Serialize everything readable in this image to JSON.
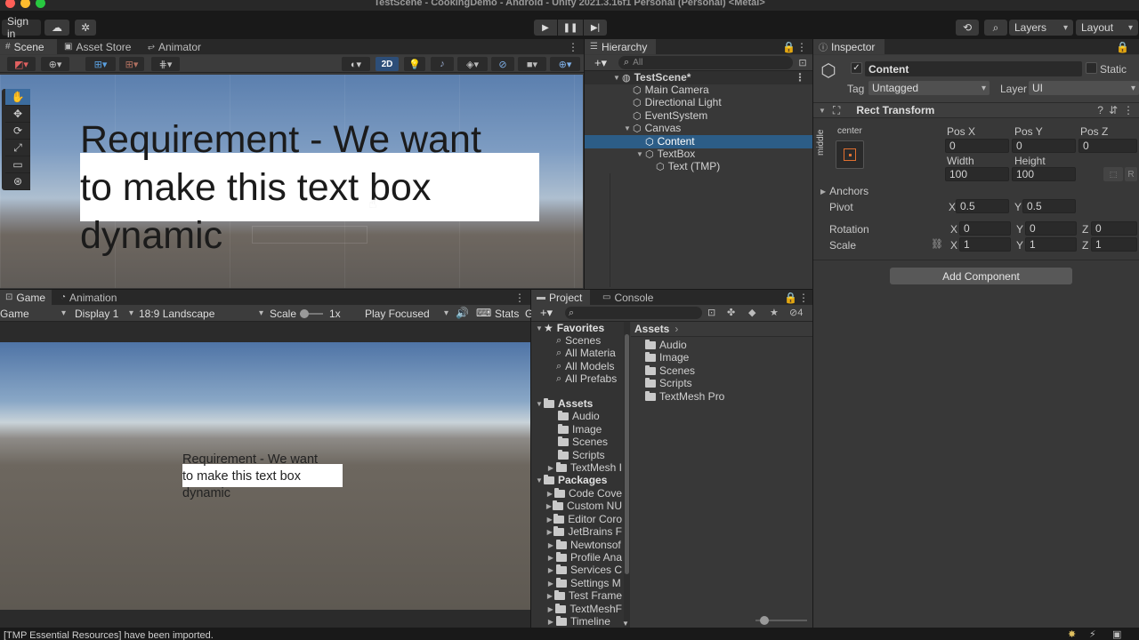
{
  "window": {
    "title": "TestScene - CookingDemo - Android - Unity 2021.3.16f1 Personal (Personal) <Metal>",
    "traffic_colors": [
      "#ff5f57",
      "#febc2e",
      "#28c840"
    ]
  },
  "toolbar": {
    "sign_in": "Sign in",
    "layers": "Layers",
    "layout": "Layout"
  },
  "scene_panel": {
    "tabs": [
      "Scene",
      "Asset Store",
      "Animator"
    ],
    "mode_2d": "2D",
    "text_line1": "Requirement - We want",
    "text_line2": "to make this text box",
    "text_line3": "dynamic"
  },
  "hierarchy": {
    "tab": "Hierarchy",
    "search_placeholder": "All",
    "items": [
      {
        "label": "TestScene*"
      },
      {
        "label": "Main Camera"
      },
      {
        "label": "Directional Light"
      },
      {
        "label": "EventSystem"
      },
      {
        "label": "Canvas"
      },
      {
        "label": "Content"
      },
      {
        "label": "TextBox"
      },
      {
        "label": "Text (TMP)"
      }
    ]
  },
  "inspector": {
    "tab": "Inspector",
    "object_name": "Content",
    "static_label": "Static",
    "tag_label": "Tag",
    "tag_value": "Untagged",
    "layer_label": "Layer",
    "layer_value": "UI",
    "component": "Rect Transform",
    "anchor_preset_h": "center",
    "anchor_preset_v": "middle",
    "pos_x_label": "Pos X",
    "pos_y_label": "Pos Y",
    "pos_z_label": "Pos Z",
    "pos_x": "0",
    "pos_y": "0",
    "pos_z": "0",
    "width_label": "Width",
    "height_label": "Height",
    "width": "100",
    "height": "100",
    "anchors_label": "Anchors",
    "pivot_label": "Pivot",
    "pivot_x": "0.5",
    "pivot_y": "0.5",
    "rotation_label": "Rotation",
    "rot_x": "0",
    "rot_y": "0",
    "rot_z": "0",
    "scale_label": "Scale",
    "scale_x": "1",
    "scale_y": "1",
    "scale_z": "1",
    "x": "X",
    "y": "Y",
    "z": "Z",
    "r": "R",
    "add_component": "Add Component"
  },
  "game_panel": {
    "tabs": [
      "Game",
      "Animation"
    ],
    "mode": "Game",
    "display": "Display 1",
    "aspect": "18:9 Landscape",
    "scale_label": "Scale",
    "scale_value": "1x",
    "play_mode": "Play Focused",
    "stats": "Stats",
    "gizmos_letter": "G",
    "text_line1": "Requirement - We want",
    "text_line2": "to make this text box",
    "text_line3": "dynamic"
  },
  "project_panel": {
    "tabs": [
      "Project",
      "Console"
    ],
    "hidden_count": "4",
    "favorites_label": "Favorites",
    "favorites": [
      "Scenes",
      "All Materia",
      "All Models",
      "All Prefabs"
    ],
    "assets_label": "Assets",
    "assets_tree": [
      "Audio",
      "Image",
      "Scenes",
      "Scripts",
      "TextMesh I"
    ],
    "packages_label": "Packages",
    "packages": [
      "Code Cove",
      "Custom NU",
      "Editor Coro",
      "JetBrains F",
      "Newtonsof",
      "Profile Ana",
      "Services C",
      "Settings M",
      "Test Frame",
      "TextMeshF",
      "Timeline"
    ],
    "breadcrumb": "Assets",
    "assets_list": [
      "Audio",
      "Image",
      "Scenes",
      "Scripts",
      "TextMesh Pro"
    ],
    "slider_value": 0.1
  },
  "status_bar": {
    "message": "[TMP Essential Resources] have been imported."
  }
}
